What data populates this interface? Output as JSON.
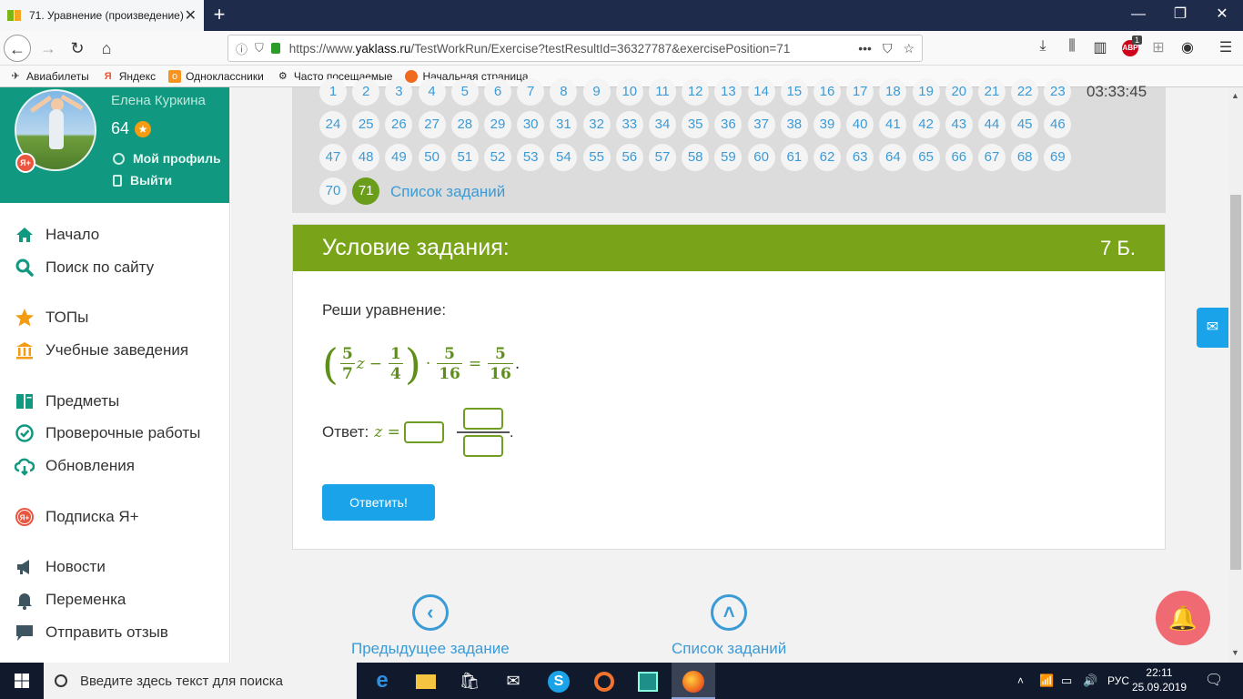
{
  "browser": {
    "tab_title": "71. Уравнение (произведение)",
    "url_plain1": "https://www.",
    "url_domain": "yaklass.ru",
    "url_plain2": "/TestWorkRun/Exercise?testResultId=36327787&exercisePosition=71",
    "abp_badge": "1",
    "abp_label": "ABP"
  },
  "bookmarks": [
    {
      "label": "Авиабилеты",
      "icon": "plane-icon"
    },
    {
      "label": "Яндекс",
      "icon": "yandex-icon"
    },
    {
      "label": "Одноклассники",
      "icon": "ok-icon"
    },
    {
      "label": "Часто посещаемые",
      "icon": "gear-icon"
    },
    {
      "label": "Начальная страница",
      "icon": "firefox-icon"
    }
  ],
  "profile": {
    "name": "Елена Куркина",
    "score": "64",
    "my_profile": "Мой профиль",
    "logout": "Выйти",
    "badge": "Я+"
  },
  "menu": [
    {
      "label": "Начало",
      "icon": "home-icon"
    },
    {
      "label": "Поиск по сайту",
      "icon": "search-icon"
    },
    {
      "label": "ТОПы",
      "icon": "star-icon"
    },
    {
      "label": "Учебные заведения",
      "icon": "school-icon"
    },
    {
      "label": "Предметы",
      "icon": "book-icon"
    },
    {
      "label": "Проверочные работы",
      "icon": "check-icon"
    },
    {
      "label": "Обновления",
      "icon": "cloud-icon"
    },
    {
      "label": "Подписка Я+",
      "icon": "ya-plus-icon"
    },
    {
      "label": "Новости",
      "icon": "megaphone-icon"
    },
    {
      "label": "Переменка",
      "icon": "bell-icon"
    },
    {
      "label": "Отправить отзыв",
      "icon": "message-icon"
    }
  ],
  "tasks": {
    "numbers": [
      "1",
      "2",
      "3",
      "4",
      "5",
      "6",
      "7",
      "8",
      "9",
      "10",
      "11",
      "12",
      "13",
      "14",
      "15",
      "16",
      "17",
      "18",
      "19",
      "20",
      "21",
      "22",
      "23",
      "24",
      "25",
      "26",
      "27",
      "28",
      "29",
      "30",
      "31",
      "32",
      "33",
      "34",
      "35",
      "36",
      "37",
      "38",
      "39",
      "40",
      "41",
      "42",
      "43",
      "44",
      "45",
      "46",
      "47",
      "48",
      "49",
      "50",
      "51",
      "52",
      "53",
      "54",
      "55",
      "56",
      "57",
      "58",
      "59",
      "60",
      "61",
      "62",
      "63",
      "64",
      "65",
      "66",
      "67",
      "68",
      "69",
      "70",
      "71"
    ],
    "active": "71",
    "list_link": "Список заданий",
    "timer": "03:33:45"
  },
  "card": {
    "title": "Условие задания:",
    "points": "7 Б.",
    "prompt": "Реши уравнение:",
    "formula": {
      "a_num": "5",
      "a_den": "7",
      "var": "z",
      "minus": "−",
      "b_num": "1",
      "b_den": "4",
      "dot": "·",
      "c_num": "5",
      "c_den": "16",
      "eq": "=",
      "d_num": "5",
      "d_den": "16",
      "end": "."
    },
    "answer_label": "Ответ:",
    "answer_var": "z =",
    "answer_end": ".",
    "submit": "Ответить!"
  },
  "bottom_nav": {
    "prev": "Предыдущее задание",
    "list": "Список заданий"
  },
  "taskbar": {
    "search_placeholder": "Введите здесь текст для поиска",
    "lang": "РУС",
    "time": "22:11",
    "date": "25.09.2019"
  }
}
